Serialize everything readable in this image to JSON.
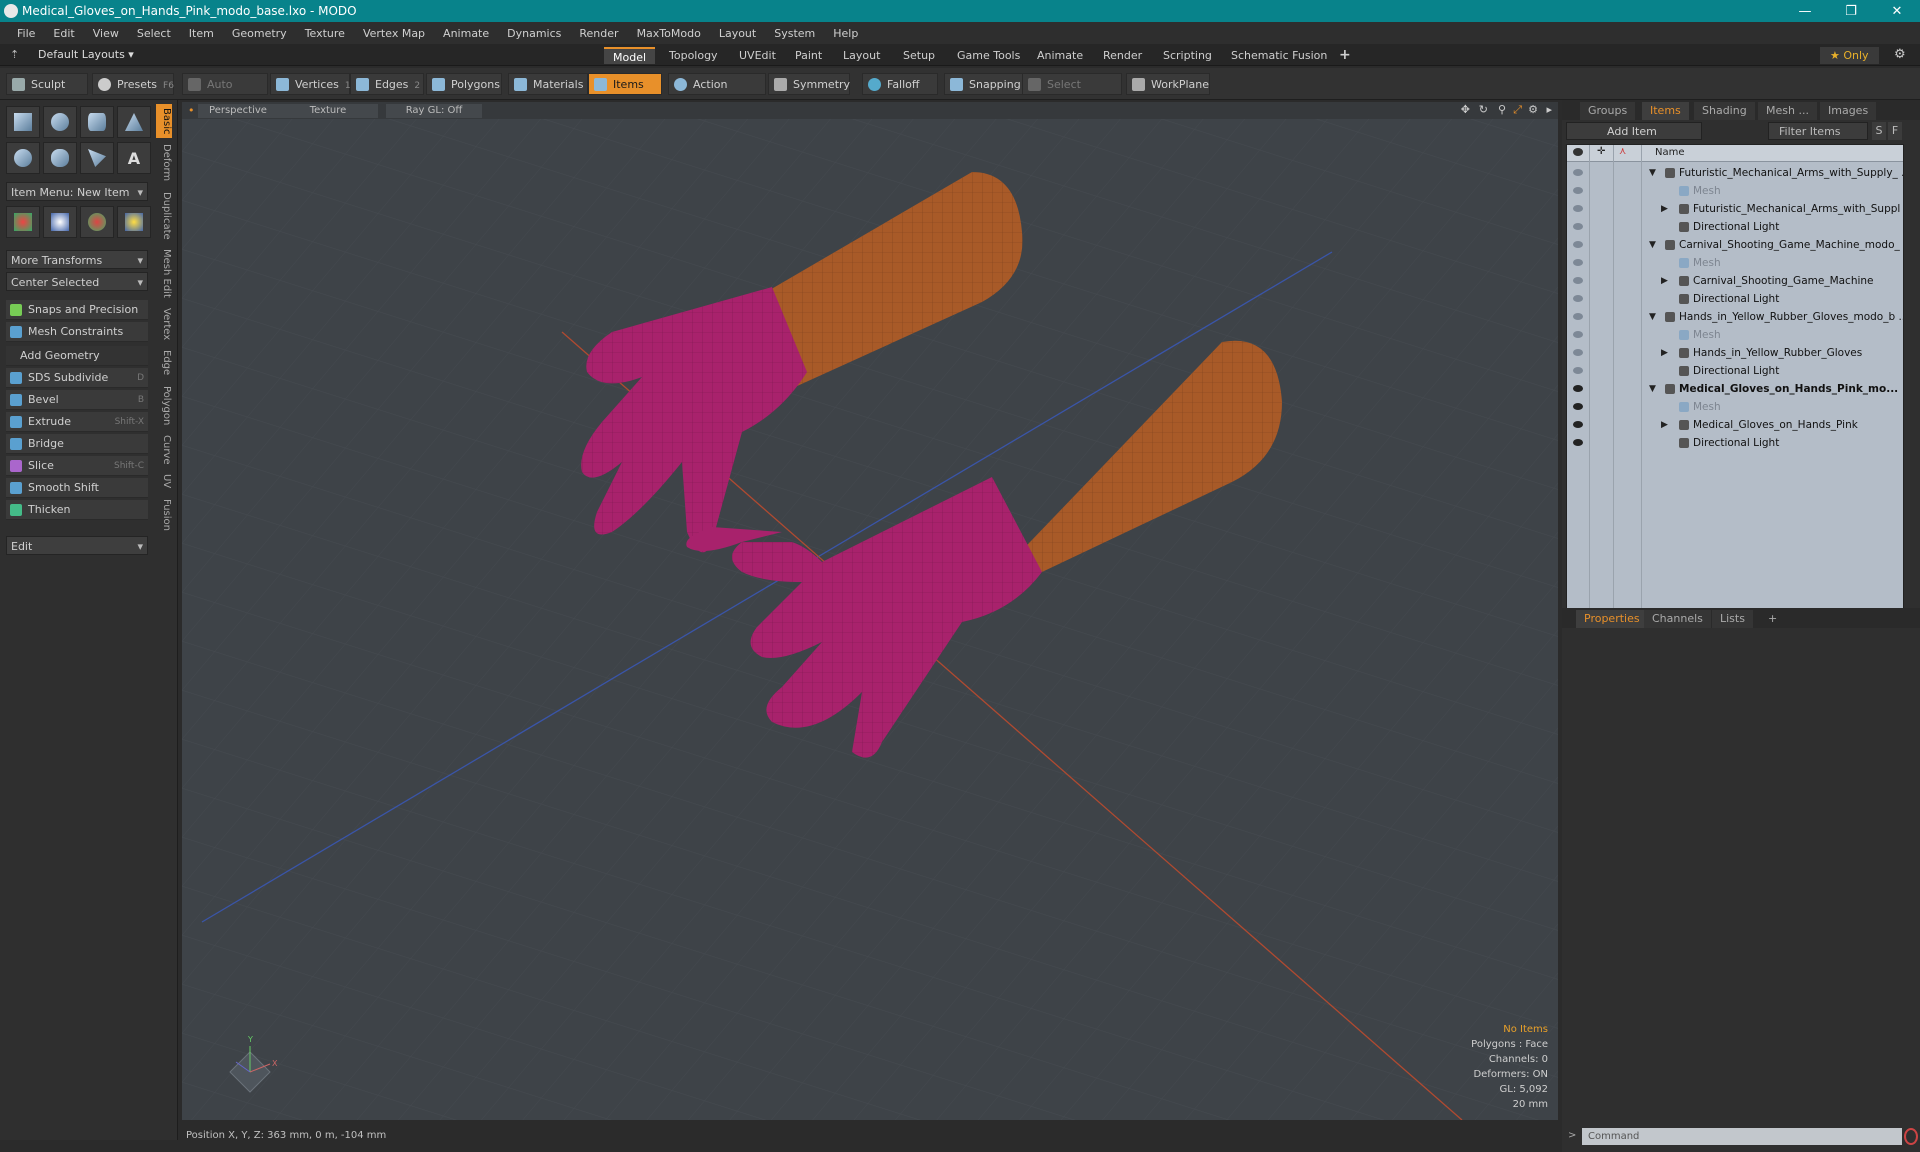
{
  "window": {
    "title": "Medical_Gloves_on_Hands_Pink_modo_base.lxo - MODO",
    "min": "—",
    "restore": "❐",
    "close": "✕"
  },
  "menu": [
    "File",
    "Edit",
    "View",
    "Select",
    "Item",
    "Geometry",
    "Texture",
    "Vertex Map",
    "Animate",
    "Dynamics",
    "Render",
    "MaxToModo",
    "Layout",
    "System",
    "Help"
  ],
  "layoutbar": {
    "default_layouts": "Default Layouts ▾",
    "tabs": [
      "Model",
      "Topology",
      "UVEdit",
      "Paint",
      "Layout",
      "Setup",
      "Game Tools",
      "Animate",
      "Render",
      "Scripting",
      "Schematic Fusion"
    ],
    "add": "+",
    "only": "★  Only"
  },
  "toolbar": {
    "sculpt": "Sculpt",
    "presets": "Presets",
    "presets_key": "F6",
    "auto_select": "Auto Select",
    "vertices": "Vertices",
    "vertices_key": "1",
    "edges": "Edges",
    "edges_key": "2",
    "polygons": "Polygons",
    "materials": "Materials",
    "items": "Items",
    "action_center": "Action Center",
    "symmetry": "Symmetry",
    "falloff": "Falloff",
    "snapping": "Snapping",
    "select_through": "Select Through",
    "workplane": "WorkPlane"
  },
  "leftpanel": {
    "item_menu": "Item Menu: New Item",
    "more_transforms": "More Transforms",
    "center_selected": "Center Selected",
    "snaps": "Snaps and Precision",
    "mesh_constraints": "Mesh Constraints",
    "add_geometry": "Add Geometry",
    "tools": [
      {
        "label": "SDS Subdivide",
        "key": "D"
      },
      {
        "label": "Bevel",
        "key": "B"
      },
      {
        "label": "Extrude",
        "key": "Shift-X"
      },
      {
        "label": "Bridge",
        "key": ""
      },
      {
        "label": "Slice",
        "key": "Shift-C"
      },
      {
        "label": "Smooth Shift",
        "key": ""
      },
      {
        "label": "Thicken",
        "key": ""
      }
    ],
    "edit": "Edit",
    "vtabs": [
      "Basic",
      "Deform",
      "Duplicate",
      "Mesh Edit",
      "Vertex",
      "Edge",
      "Polygon",
      "Curve",
      "UV",
      "Fusion"
    ]
  },
  "viewport": {
    "perspective": "Perspective",
    "texture": "Texture",
    "raygl": "Ray GL: Off",
    "info": {
      "no_items": "No Items",
      "polygons": "Polygons : Face",
      "channels": "Channels: 0",
      "deformers": "Deformers: ON",
      "gl": "GL: 5,092",
      "scale": "20 mm"
    },
    "colors": {
      "glove": "#a8226c",
      "sleeve": "#a85a28",
      "bg": "#3e4348"
    }
  },
  "status": {
    "position": "Position X, Y, Z:   363 mm, 0 m, -104 mm"
  },
  "rightpanel": {
    "tabs": [
      "Groups",
      "Items",
      "Shading",
      "Mesh ...",
      "Images"
    ],
    "add_item": "Add Item",
    "filter_items": "Filter Items",
    "s": "S",
    "f": "F",
    "col_name": "Name",
    "rows": [
      {
        "label": "Futuristic_Mechanical_Arms_with_Supply_ ...",
        "lvl": 0,
        "exp": "▼",
        "style": "",
        "eye": "off"
      },
      {
        "label": "Mesh",
        "lvl": 1,
        "exp": "",
        "style": "dimmed",
        "eye": "off"
      },
      {
        "label": "Futuristic_Mechanical_Arms_with_Suppl",
        "lvl": 1,
        "exp": "▶",
        "style": "",
        "eye": "off"
      },
      {
        "label": "Directional Light",
        "lvl": 1,
        "exp": "",
        "style": "",
        "eye": "off"
      },
      {
        "label": "Carnival_Shooting_Game_Machine_modo_ ...",
        "lvl": 0,
        "exp": "▼",
        "style": "",
        "eye": "off"
      },
      {
        "label": "Mesh",
        "lvl": 1,
        "exp": "",
        "style": "dimmed",
        "eye": "off"
      },
      {
        "label": "Carnival_Shooting_Game_Machine",
        "lvl": 1,
        "exp": "▶",
        "style": "",
        "eye": "off"
      },
      {
        "label": "Directional Light",
        "lvl": 1,
        "exp": "",
        "style": "",
        "eye": "off"
      },
      {
        "label": "Hands_in_Yellow_Rubber_Gloves_modo_b ...",
        "lvl": 0,
        "exp": "▼",
        "style": "",
        "eye": "off"
      },
      {
        "label": "Mesh",
        "lvl": 1,
        "exp": "",
        "style": "dimmed",
        "eye": "off"
      },
      {
        "label": "Hands_in_Yellow_Rubber_Gloves",
        "lvl": 1,
        "exp": "▶",
        "style": "",
        "eye": "off"
      },
      {
        "label": "Directional Light",
        "lvl": 1,
        "exp": "",
        "style": "",
        "eye": "off"
      },
      {
        "label": "Medical_Gloves_on_Hands_Pink_mo...",
        "lvl": 0,
        "exp": "▼",
        "style": "bold",
        "eye": "on"
      },
      {
        "label": "Mesh",
        "lvl": 1,
        "exp": "",
        "style": "dimmed",
        "eye": "on"
      },
      {
        "label": "Medical_Gloves_on_Hands_Pink",
        "lvl": 1,
        "exp": "▶",
        "style": "",
        "eye": "on"
      },
      {
        "label": "Directional Light",
        "lvl": 1,
        "exp": "",
        "style": "",
        "eye": "on"
      }
    ],
    "prop_tabs": [
      "Properties",
      "Channels",
      "Lists"
    ],
    "prop_add": "+",
    "command_placeholder": "Command"
  }
}
